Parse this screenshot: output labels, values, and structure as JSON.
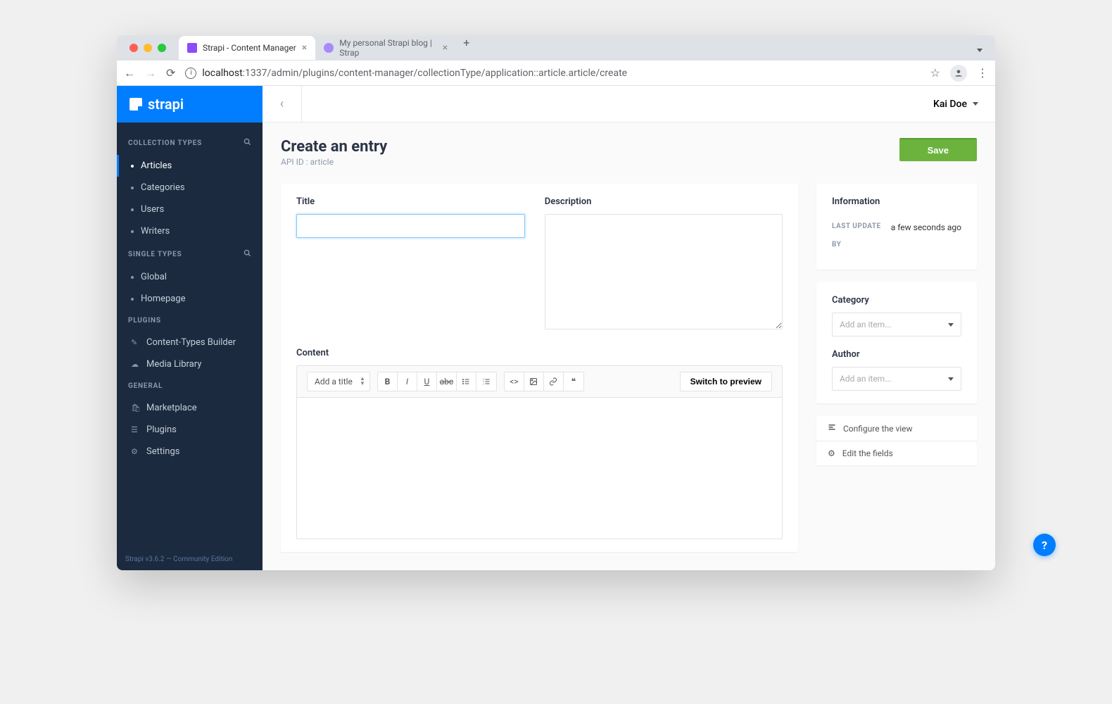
{
  "browser": {
    "tabs": [
      {
        "title": "Strapi - Content Manager",
        "active": true
      },
      {
        "title": "My personal Strapi blog | Strap",
        "active": false
      }
    ],
    "url_host": "localhost",
    "url_port": ":1337",
    "url_path": "/admin/plugins/content-manager/collectionType/application::article.article/create"
  },
  "logo": "strapi",
  "sidebar": {
    "collection_types_label": "COLLECTION TYPES",
    "collection_types": [
      {
        "label": "Articles",
        "active": true
      },
      {
        "label": "Categories"
      },
      {
        "label": "Users"
      },
      {
        "label": "Writers"
      }
    ],
    "single_types_label": "SINGLE TYPES",
    "single_types": [
      {
        "label": "Global"
      },
      {
        "label": "Homepage"
      }
    ],
    "plugins_label": "PLUGINS",
    "plugins": [
      {
        "label": "Content-Types Builder",
        "icon": "brush"
      },
      {
        "label": "Media Library",
        "icon": "cloud"
      }
    ],
    "general_label": "GENERAL",
    "general": [
      {
        "label": "Marketplace",
        "icon": "bag"
      },
      {
        "label": "Plugins",
        "icon": "list"
      },
      {
        "label": "Settings",
        "icon": "gear"
      }
    ],
    "version": "Strapi v3.6.2 — Community Edition"
  },
  "header": {
    "user": "Kai Doe"
  },
  "page": {
    "title": "Create an entry",
    "subtitle": "API ID : article",
    "save": "Save"
  },
  "fields": {
    "title_label": "Title",
    "description_label": "Description",
    "content_label": "Content",
    "title_value": "",
    "description_value": ""
  },
  "editor": {
    "title_select": "Add a title",
    "preview": "Switch to preview"
  },
  "info_panel": {
    "heading": "Information",
    "last_update_key": "LAST UPDATE",
    "last_update_val": "a few seconds ago",
    "by_key": "BY",
    "by_val": ""
  },
  "relations": {
    "category_label": "Category",
    "author_label": "Author",
    "placeholder": "Add an item..."
  },
  "actions": {
    "configure": "Configure the view",
    "edit_fields": "Edit the fields"
  },
  "help": "?"
}
